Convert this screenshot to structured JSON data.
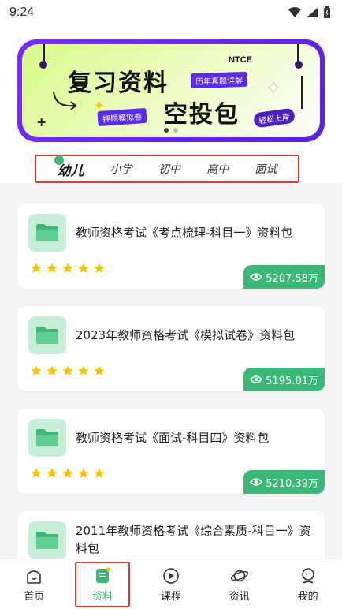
{
  "status_bar": {
    "time": "9:24"
  },
  "banner": {
    "title_line1": "复习资料",
    "title_line2": "空投包",
    "brand": "NTCE",
    "tag_past_exams": "历年真题详解",
    "tag_predict": "押题模拟卷",
    "tag_easy": "轻松上岸"
  },
  "tabs": [
    {
      "label": "幼儿",
      "active": true
    },
    {
      "label": "小学",
      "active": false
    },
    {
      "label": "初中",
      "active": false
    },
    {
      "label": "高中",
      "active": false
    },
    {
      "label": "面试",
      "active": false
    }
  ],
  "cards": [
    {
      "title": "教师资格考试《考点梳理-科目一》资料包",
      "views": "5207.58万",
      "stars": 5
    },
    {
      "title": "2023年教师资格考试《模拟试卷》资料包",
      "views": "5195.01万",
      "stars": 5
    },
    {
      "title": "教师资格考试《面试-科目四》资料包",
      "views": "5210.39万",
      "stars": 5
    },
    {
      "title": "2011年教师资格考试《综合素质-科目一》资料包",
      "views": "",
      "stars": 0
    }
  ],
  "bottom_nav": [
    {
      "label": "首页",
      "icon": "home-icon",
      "active": false
    },
    {
      "label": "资料",
      "icon": "document-icon",
      "active": true
    },
    {
      "label": "课程",
      "icon": "play-icon",
      "active": false
    },
    {
      "label": "资讯",
      "icon": "planet-icon",
      "active": false
    },
    {
      "label": "我的",
      "icon": "profile-icon",
      "active": false
    }
  ],
  "colors": {
    "accent": "#3bb877",
    "highlight_border": "#e03b2c",
    "star": "#f5c400",
    "banner_frame": "#6a24f0"
  }
}
